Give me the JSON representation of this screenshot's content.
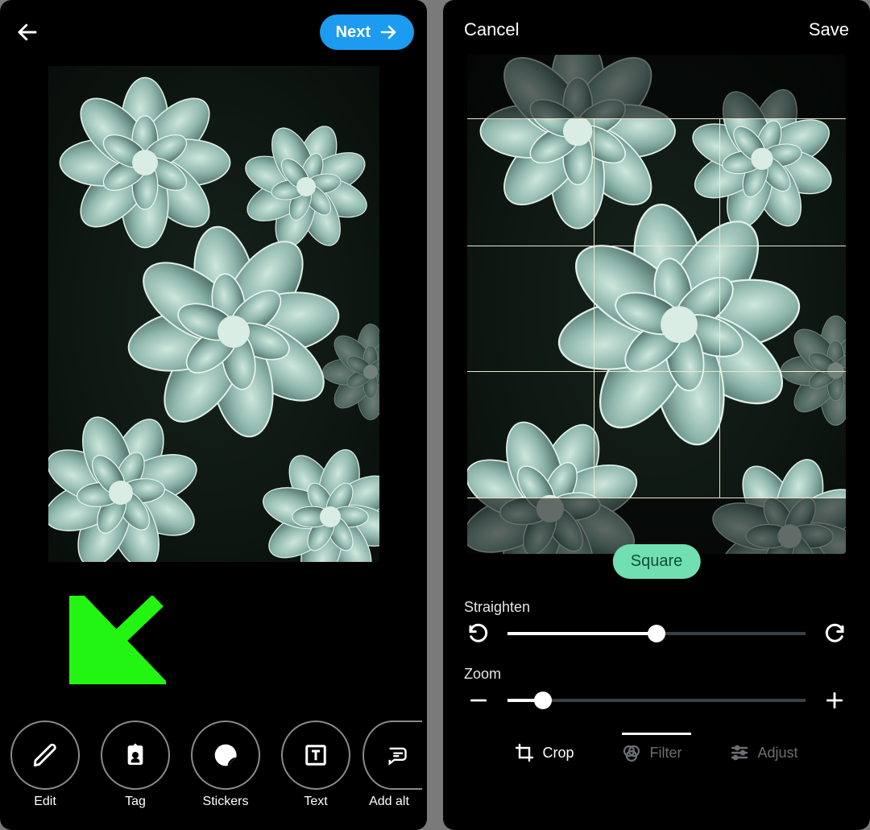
{
  "left": {
    "next_label": "Next",
    "tools": {
      "edit": "Edit",
      "tag": "Tag",
      "stickers": "Stickers",
      "text": "Text",
      "addalt": "Add alt"
    }
  },
  "right": {
    "cancel_label": "Cancel",
    "save_label": "Save",
    "crop_shape_label": "Square",
    "straighten": {
      "label": "Straighten",
      "value_pct": 50
    },
    "zoom": {
      "label": "Zoom",
      "value_pct": 12
    },
    "tabs": {
      "crop": "Crop",
      "filter": "Filter",
      "adjust": "Adjust",
      "active": "crop"
    }
  },
  "colors": {
    "accent_blue": "#1d9bf0",
    "accent_green": "#71dfb1",
    "callout_arrow": "#22f512"
  }
}
